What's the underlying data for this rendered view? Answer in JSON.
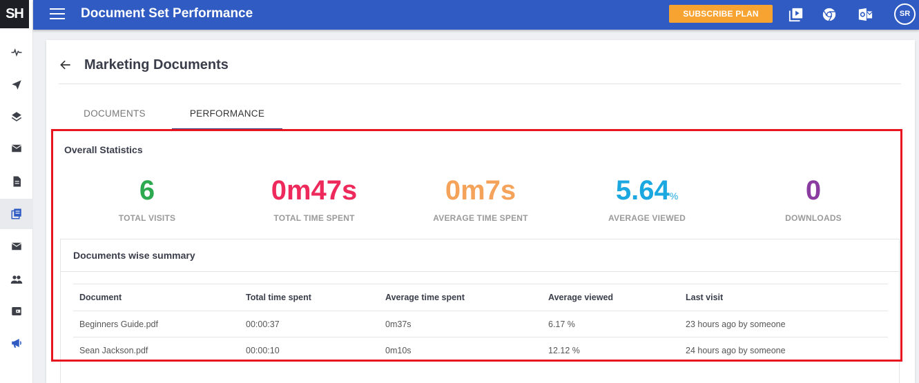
{
  "app": {
    "logo": "SH",
    "title": "Document Set Performance"
  },
  "topbar": {
    "subscribe_label": "SUBSCRIBE PLAN",
    "avatar": "SR"
  },
  "page": {
    "title": "Marketing Documents"
  },
  "tabs": [
    {
      "label": "DOCUMENTS",
      "active": false
    },
    {
      "label": "PERFORMANCE",
      "active": true
    }
  ],
  "overall": {
    "title": "Overall Statistics",
    "stats": [
      {
        "value": "6",
        "unit": "",
        "label": "TOTAL VISITS",
        "color": "#2daa4f"
      },
      {
        "value": "0m47s",
        "unit": "",
        "label": "TOTAL TIME SPENT",
        "color": "#ee2a5c"
      },
      {
        "value": "0m7s",
        "unit": "",
        "label": "AVERAGE TIME SPENT",
        "color": "#f5a35a"
      },
      {
        "value": "5.64",
        "unit": "%",
        "label": "AVERAGE VIEWED",
        "color": "#1ba7e0"
      },
      {
        "value": "0",
        "unit": "",
        "label": "DOWNLOADS",
        "color": "#8b3ca0"
      }
    ]
  },
  "summary": {
    "title": "Documents wise summary",
    "columns": [
      "Document",
      "Total time spent",
      "Average time spent",
      "Average viewed",
      "Last visit"
    ],
    "rows": [
      [
        "Beginners Guide.pdf",
        "00:00:37",
        "0m37s",
        "6.17 %",
        "23 hours ago by someone"
      ],
      [
        "Sean Jackson.pdf",
        "00:00:10",
        "0m10s",
        "12.12 %",
        "24 hours ago by someone"
      ]
    ]
  },
  "colors": {
    "topbar": "#2f5bc2",
    "accent": "#f6a331",
    "highlight": "#e8141f"
  }
}
